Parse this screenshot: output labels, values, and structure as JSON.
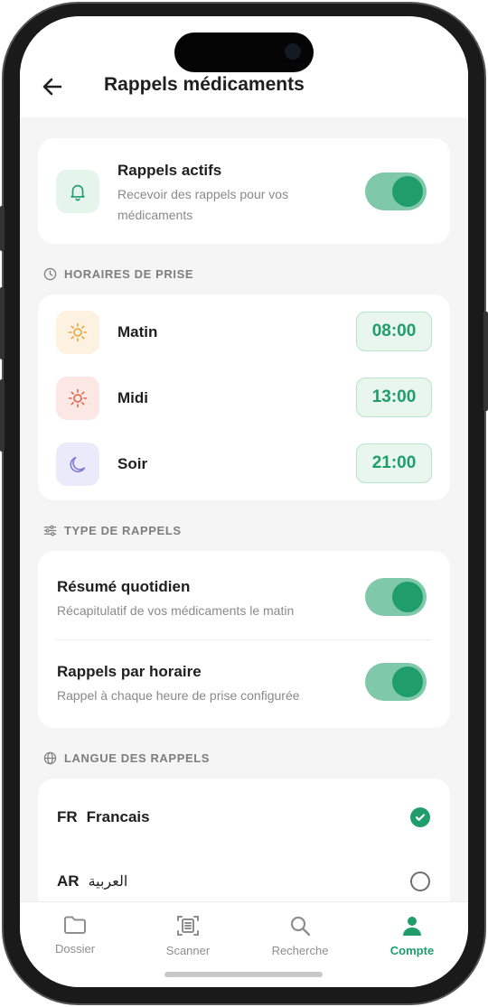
{
  "header": {
    "title": "Rappels médicaments"
  },
  "master": {
    "title": "Rappels actifs",
    "subtitle_line1": "Recevoir des rappels pour vos",
    "subtitle_line2": "médicaments",
    "enabled": true
  },
  "schedule": {
    "section_title": "HORAIRES DE PRISE",
    "items": [
      {
        "label": "Matin",
        "time": "08:00",
        "icon": "sun-icon",
        "color": "#e8a33d"
      },
      {
        "label": "Midi",
        "time": "13:00",
        "icon": "sun-icon",
        "color": "#e0644a"
      },
      {
        "label": "Soir",
        "time": "21:00",
        "icon": "moon-icon",
        "color": "#7b78d6"
      }
    ]
  },
  "types": {
    "section_title": "TYPE DE RAPPELS",
    "items": [
      {
        "title": "Résumé quotidien",
        "subtitle": "Récapitulatif de vos médicaments le matin",
        "enabled": true
      },
      {
        "title": "Rappels par horaire",
        "subtitle": "Rappel à chaque heure de prise configurée",
        "enabled": true
      }
    ]
  },
  "language": {
    "section_title": "LANGUE DES RAPPELS",
    "items": [
      {
        "code": "FR",
        "name": "Francais",
        "selected": true
      },
      {
        "code": "AR",
        "name": "العربية",
        "selected": false
      }
    ]
  },
  "tabs": [
    {
      "label": "Dossier",
      "icon": "folder-icon",
      "active": false
    },
    {
      "label": "Scanner",
      "icon": "scanner-icon",
      "active": false
    },
    {
      "label": "Recherche",
      "icon": "search-icon",
      "active": false
    },
    {
      "label": "Compte",
      "icon": "person-icon",
      "active": true
    }
  ],
  "colors": {
    "accent": "#1f9d6b",
    "toggle_track": "#7fc8aa",
    "background": "#f5f5f5"
  }
}
